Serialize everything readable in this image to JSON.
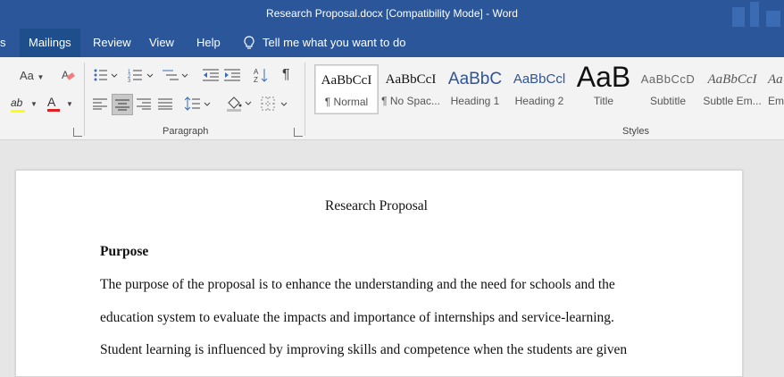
{
  "window": {
    "title": "Research Proposal.docx [Compatibility Mode]  -  Word"
  },
  "tabs": [
    {
      "label": "s"
    },
    {
      "label": "Mailings"
    },
    {
      "label": "Review"
    },
    {
      "label": "View"
    },
    {
      "label": "Help"
    }
  ],
  "tellme": {
    "label": "Tell me what you want to do",
    "icon": "lightbulb-icon"
  },
  "ribbon": {
    "font_case_label": "Aa",
    "paragraph_label": "Paragraph",
    "styles_label": "Styles",
    "pilcrow": "¶",
    "highlight_glyph": "ab",
    "font_color_glyph": "A",
    "highlight_color": "#ffff00",
    "font_color": "#e02020",
    "styles": [
      {
        "preview": "AaBbCcI",
        "name": "¶ Normal"
      },
      {
        "preview": "AaBbCcI",
        "name": "¶ No Spac..."
      },
      {
        "preview": "AaBbC",
        "name": "Heading 1"
      },
      {
        "preview": "AaBbCcl",
        "name": "Heading 2"
      },
      {
        "preview": "AaB",
        "name": "Title"
      },
      {
        "preview": "AaBbCcD",
        "name": "Subtitle"
      },
      {
        "preview": "AaBbCcI",
        "name": "Subtle Em..."
      },
      {
        "preview": "Aa",
        "name": "Em"
      }
    ]
  },
  "document": {
    "title": "Research Proposal",
    "heading": "Purpose",
    "lines": [
      "The purpose of the proposal is to enhance the understanding and the need for schools and the",
      "education system to evaluate the impacts and importance of internships and service-learning.",
      "Student learning is influenced by improving skills and competence when the students are given"
    ]
  }
}
